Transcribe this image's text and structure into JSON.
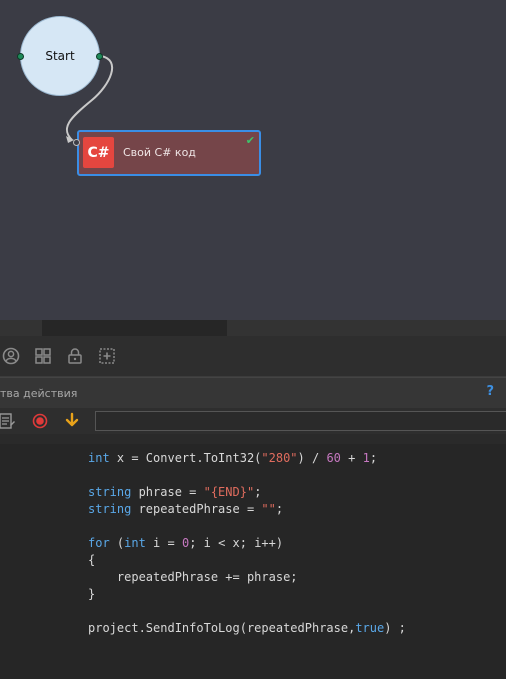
{
  "canvas": {
    "start_node": {
      "label": "Start"
    },
    "action_node": {
      "badge": "C#",
      "label": "Свой C# код",
      "status_icon": "check-icon",
      "status_color": "#3ec46b"
    }
  },
  "toolbar": {
    "icons": [
      "user-circle-icon",
      "grid-icon",
      "lock-icon",
      "add-box-icon"
    ]
  },
  "panel": {
    "title": "тва действия",
    "help": "?"
  },
  "code_toolbar": {
    "icons": [
      "list-edit-icon",
      "record-icon",
      "download-arrow-icon"
    ],
    "search_value": ""
  },
  "code": {
    "lines": [
      [
        {
          "t": "int",
          "c": "kw"
        },
        {
          "t": " x = Convert.ToInt32("
        },
        {
          "t": "\"280\"",
          "c": "str"
        },
        {
          "t": ") / "
        },
        {
          "t": "60",
          "c": "num"
        },
        {
          "t": " + "
        },
        {
          "t": "1",
          "c": "num"
        },
        {
          "t": ";"
        }
      ],
      [],
      [
        {
          "t": "string",
          "c": "kw"
        },
        {
          "t": " phrase = "
        },
        {
          "t": "\"{END}\"",
          "c": "str"
        },
        {
          "t": ";"
        }
      ],
      [
        {
          "t": "string",
          "c": "kw"
        },
        {
          "t": " repeatedPhrase = "
        },
        {
          "t": "\"\"",
          "c": "str"
        },
        {
          "t": ";"
        }
      ],
      [],
      [
        {
          "t": "for",
          "c": "kw"
        },
        {
          "t": " ("
        },
        {
          "t": "int",
          "c": "kw"
        },
        {
          "t": " i = "
        },
        {
          "t": "0",
          "c": "num"
        },
        {
          "t": "; i < x; i++)"
        }
      ],
      [
        {
          "t": "{"
        }
      ],
      [
        {
          "t": "    repeatedPhrase += phrase;"
        }
      ],
      [
        {
          "t": "}"
        }
      ],
      [],
      [
        {
          "t": "project.SendInfoToLog(repeatedPhrase,"
        },
        {
          "t": "true",
          "c": "kw"
        },
        {
          "t": ") ;"
        }
      ]
    ]
  },
  "colors": {
    "canvas_bg": "#3b3c45",
    "node_border": "#3a8ee6",
    "badge": "#e5463f",
    "keyword": "#5aa8e8",
    "string": "#e06c5e",
    "number": "#c678c0"
  }
}
